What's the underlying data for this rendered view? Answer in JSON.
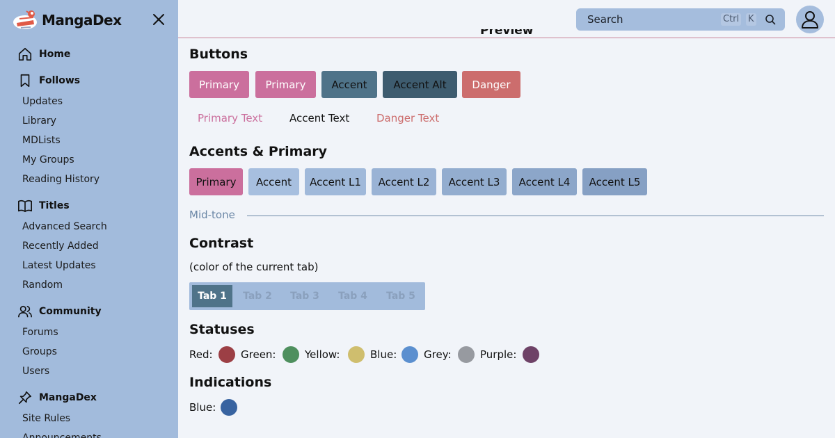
{
  "brand": {
    "name": "MangaDex"
  },
  "sidebar": {
    "sections": {
      "home": "Home",
      "follows": "Follows",
      "titles": "Titles",
      "community": "Community",
      "mangadex": "MangaDex"
    },
    "follows_items": [
      "Updates",
      "Library",
      "MDLists",
      "My Groups",
      "Reading History"
    ],
    "titles_items": [
      "Advanced Search",
      "Recently Added",
      "Latest Updates",
      "Random"
    ],
    "community_items": [
      "Forums",
      "Groups",
      "Users"
    ],
    "mangadex_items": [
      "Site Rules",
      "Announcements"
    ]
  },
  "header": {
    "search_placeholder": "Search",
    "kbd_ctrl": "Ctrl",
    "kbd_k": "K",
    "ghost_title": "Preview"
  },
  "buttons_section": {
    "title": "Buttons",
    "solid": [
      "Primary",
      "Primary",
      "Accent",
      "Accent Alt",
      "Danger"
    ],
    "text": [
      "Primary Text",
      "Accent Text",
      "Danger Text"
    ]
  },
  "accents_section": {
    "title": "Accents & Primary",
    "items": [
      "Primary",
      "Accent",
      "Accent L1",
      "Accent L2",
      "Accent L3",
      "Accent L4",
      "Accent L5"
    ],
    "midtone": "Mid-tone"
  },
  "contrast_section": {
    "title": "Contrast",
    "note": "(color of the current tab)",
    "tabs": [
      "Tab 1",
      "Tab 2",
      "Tab 3",
      "Tab 4",
      "Tab 5"
    ],
    "active_tab": "Tab 1"
  },
  "statuses_section": {
    "title": "Statuses",
    "items": [
      {
        "label": "Red:",
        "color": "#9c3f45"
      },
      {
        "label": "Green:",
        "color": "#4e8f5e"
      },
      {
        "label": "Yellow:",
        "color": "#cfbe6e"
      },
      {
        "label": "Blue:",
        "color": "#5b8fcf"
      },
      {
        "label": "Grey:",
        "color": "#979aa0"
      },
      {
        "label": "Purple:",
        "color": "#6e4267"
      }
    ]
  },
  "indications_section": {
    "title": "Indications",
    "items": [
      {
        "label": "Blue:",
        "color": "#3863a0"
      }
    ]
  },
  "colors": {
    "primary": "#cb6f9d",
    "accent": "#4f7389",
    "accent_alt": "#3e5c6f",
    "danger": "#cc6d6d",
    "sidebar_bg": "#a2bbdc",
    "page_bg": "#f1f4f9"
  }
}
